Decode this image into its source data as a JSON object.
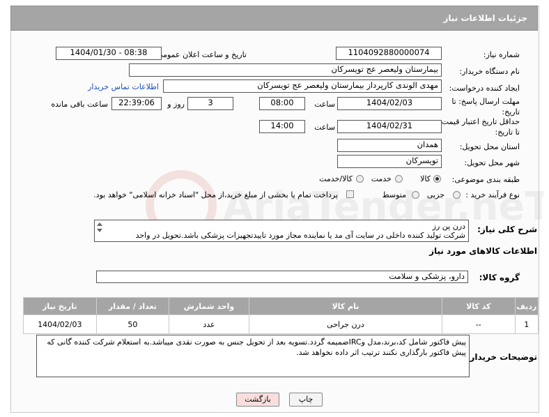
{
  "header": {
    "title": "جزئیات اطلاعات نیاز"
  },
  "fields": {
    "need_number_label": "شماره نیاز:",
    "need_number": "1104092880000074",
    "announce_label": "تاریخ و ساعت اعلان عمومی:",
    "announce_value": "1404/01/30 - 08:38",
    "buyer_org_label": "نام دستگاه خریدار:",
    "buyer_org": "بیمارستان ولیعصر  عج  تویسرکان",
    "creator_label": "ایجاد کننده درخواست:",
    "creator": "مهدی الوندی کارپرداز بیمارستان ولیعصر  عج  تویسرکان",
    "buyer_contact_link": "اطلاعات تماس خریدار",
    "deadline_label_1": "مهلت ارسال پاسخ: تا",
    "deadline_label_2": "تاریخ:",
    "deadline_date": "1404/02/03",
    "time_label": "ساعت",
    "deadline_time": "08:00",
    "days_value": "3",
    "days_label": "روز و",
    "remaining_time": "22:39:06",
    "remaining_label": "ساعت باقی مانده",
    "validity_label_1": "حداقل تاریخ اعتبار قیمت:",
    "validity_label_2": "تا تاریخ:",
    "validity_date": "1404/02/31",
    "validity_time": "14:00",
    "province_label": "استان محل تحویل:",
    "province": "همدان",
    "city_label": "شهر محل تحویل:",
    "city": "تویسرکان",
    "category_label": "طبقه بندی موضوعی:",
    "category_options": [
      "کالا",
      "خدمت",
      "کالا/خدمت"
    ],
    "process_label": "نوع فرآیند خرید :",
    "process_options": [
      "جزیی",
      "متوسط"
    ],
    "payment_note": "پرداخت تمام یا بخشی از مبلغ خرید،از محل \"اسناد خزانه اسلامی\" خواهد بود."
  },
  "summary": {
    "label": "شرح کلی نیاز:",
    "line1": "درن پن رز",
    "line2": "شرکت تولید کننده داخلی در سایت آی مد یا نماینده مجاز مورد تاییدتجهیزات پزشکی باشد.تحویل در واحد"
  },
  "goods_section": {
    "title": "اطلاعات کالاهای مورد نیاز",
    "group_label": "گروه کالا:",
    "group_value": "دارو، پزشکی و سلامت"
  },
  "table": {
    "headers": [
      "ردیف",
      "کد کالا",
      "نام کالا",
      "واحد شمارش",
      "تعداد / مقدار",
      "تاریخ نیاز"
    ],
    "rows": [
      [
        "1",
        "--",
        "درن جراحی",
        "عدد",
        "50",
        "1404/02/03"
      ]
    ]
  },
  "notes": {
    "label": "توضیحات خریدار:",
    "text": "پیش فاکتور شامل کد،برند،مدل وIRCضمیمه گردد.تسویه بعد از تحویل جنس به صورت نقدی میباشد.به استعلام شرکت کننده گانی که پیش فاکتور بارگذاری نکنند ترتیب اثر داده نخواهد شد."
  },
  "buttons": {
    "print": "چاپ",
    "back": "بازگشت"
  },
  "watermark": {
    "text": "AriaTender.neT"
  },
  "colors": {
    "header": "#a5a5a5",
    "link": "#1a4fb8",
    "back_button": "#f9dede"
  }
}
